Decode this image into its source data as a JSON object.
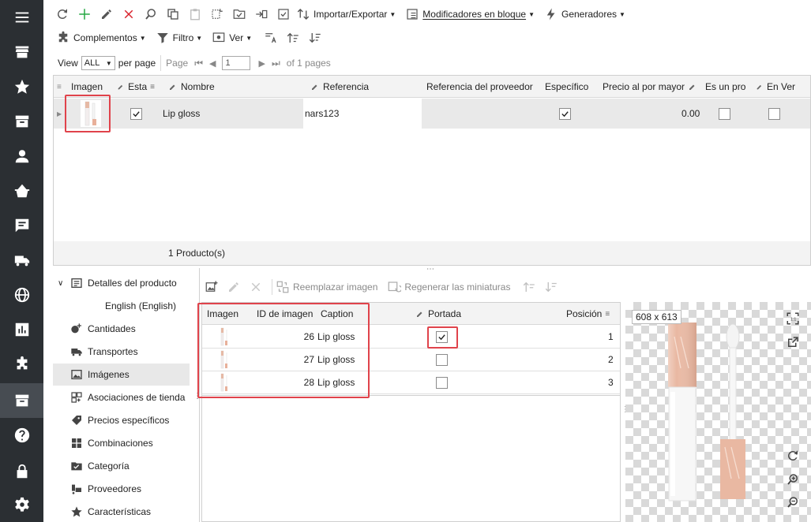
{
  "rail": {
    "items": [
      "menu",
      "store",
      "star",
      "box",
      "user",
      "basket",
      "chat",
      "truck",
      "globe",
      "chart",
      "puzzle",
      "catalog",
      "help",
      "lock",
      "gear"
    ]
  },
  "toolbar1": {
    "import_export": "Importar/Exportar",
    "bulk_modifiers": "Modificadores en bloque",
    "generators": "Generadores"
  },
  "toolbar2": {
    "addons": "Complementos",
    "filter": "Filtro",
    "view": "Ver"
  },
  "pager": {
    "view_label": "View",
    "view_value": "ALL",
    "per_page": "per page",
    "page_label": "Page",
    "page_value": "1",
    "of_pages": "of 1 pages"
  },
  "product_grid": {
    "columns": [
      "Imagen",
      "Esta",
      "Nombre",
      "Referencia",
      "Referencia del proveedor",
      "Específico",
      "Precio al por mayor",
      "Es un pro",
      "En Ver"
    ],
    "rows": [
      {
        "name": "Lip gloss",
        "reference": "nars123",
        "supplier_ref": "",
        "wholesale": "0.00",
        "enabled": true,
        "specific": true,
        "is_pack": false,
        "on_sale": false
      }
    ],
    "footer": "1 Producto(s)"
  },
  "tree": {
    "items": [
      {
        "label": "Detalles del producto",
        "icon": "details-icon"
      },
      {
        "label": "English (English)",
        "icon": ""
      },
      {
        "label": "Cantidades",
        "icon": "quantity-icon"
      },
      {
        "label": "Transportes",
        "icon": "truck-icon"
      },
      {
        "label": "Imágenes",
        "icon": "image-icon"
      },
      {
        "label": "Asociaciones de tienda",
        "icon": "store-icon"
      },
      {
        "label": "Precios específicos",
        "icon": "tag-icon"
      },
      {
        "label": "Combinaciones",
        "icon": "grid-icon"
      },
      {
        "label": "Categoría",
        "icon": "folder-icon"
      },
      {
        "label": "Proveedores",
        "icon": "supplier-icon"
      },
      {
        "label": "Características",
        "icon": "star-icon"
      }
    ]
  },
  "images_toolbar": {
    "replace": "Reemplazar imagen",
    "regenerate": "Regenerar las miniaturas"
  },
  "images_grid": {
    "columns": [
      "Imagen",
      "ID de imagen",
      "Caption",
      "Portada",
      "Posición"
    ],
    "rows": [
      {
        "id": "26",
        "caption": "Lip gloss",
        "cover": true,
        "position": "1"
      },
      {
        "id": "27",
        "caption": "Lip gloss",
        "cover": false,
        "position": "2"
      },
      {
        "id": "28",
        "caption": "Lip gloss",
        "cover": false,
        "position": "3"
      }
    ]
  },
  "preview": {
    "size": "608 x 613"
  },
  "colors": {
    "rail_bg": "#2b2f33",
    "highlight_red": "#e0434b",
    "add_green": "#27a844",
    "delete_red": "#d9232d"
  }
}
